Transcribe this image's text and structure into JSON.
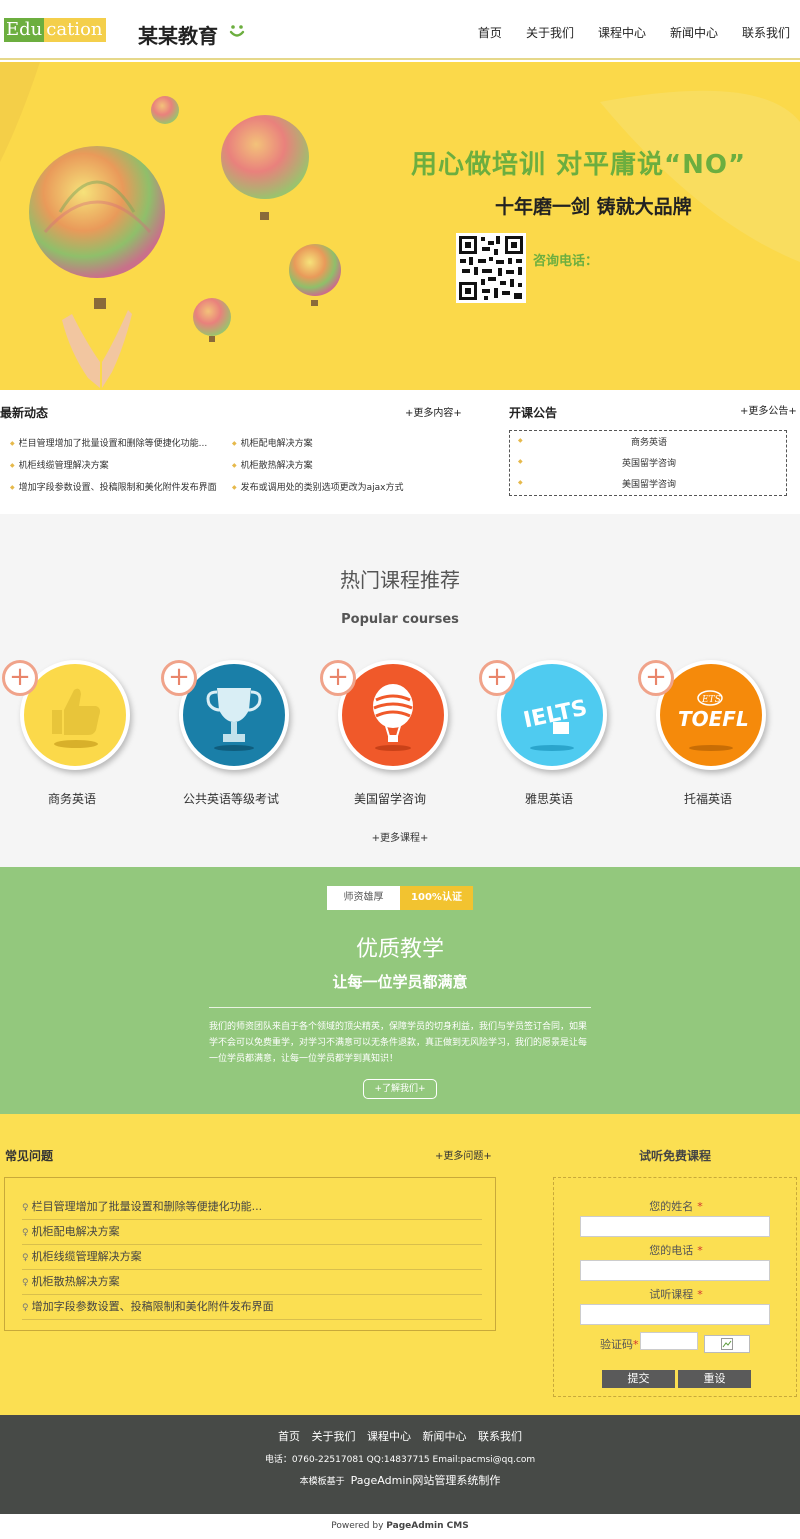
{
  "header": {
    "logo_left": "Edu",
    "logo_right": "cation",
    "site_name": "某某教育",
    "nav": [
      "首页",
      "关于我们",
      "课程中心",
      "新闻中心",
      "联系我们"
    ]
  },
  "banner": {
    "title": "用心做培训 对平庸说“NO”",
    "subtitle": "十年磨一剑 铸就大品牌",
    "phone_label": "咨询电话："
  },
  "news": {
    "title": "最新动态",
    "more": "+更多内容+",
    "items_left": [
      "栏目管理增加了批量设置和删除等便捷化功能...",
      "机柜线缆管理解决方案",
      "增加字段参数设置、投稿限制和美化附件发布界面"
    ],
    "items_right": [
      "机柜配电解决方案",
      "机柜散热解决方案",
      "发布或调用处的类别选项更改为ajax方式"
    ]
  },
  "notice": {
    "title": "开课公告",
    "more": "+更多公告+",
    "items": [
      "商务英语",
      "英国留学咨询",
      "美国留学咨询"
    ]
  },
  "courses": {
    "title": "热门课程推荐",
    "subtitle": "Popular courses",
    "plus": "+",
    "items": [
      {
        "name": "商务英语",
        "color": "#fbd94a"
      },
      {
        "name": "公共英语等级考试",
        "color": "#1a7fa8"
      },
      {
        "name": "美国留学咨询",
        "color": "#f0592a"
      },
      {
        "name": "雅思英语",
        "color": "#4fcbf0"
      },
      {
        "name": "托福英语",
        "color": "#f58a0b"
      }
    ],
    "ielts": "IELTS",
    "toefl": "TOEFL",
    "ets": "ETS",
    "more": "+更多课程+"
  },
  "quality": {
    "tag_left": "师资雄厚",
    "tag_right": "100%认证",
    "title": "优质教学",
    "subtitle": "让每一位学员都满意",
    "description": "我们的师资团队来自于各个领域的顶尖精英，保障学员的切身利益，我们与学员签订合同，如果学不会可以免费重学，对学习不满意可以无条件退款，真正做到无风险学习，我们的愿景是让每一位学员都满意，让每一位学员都学到真知识！",
    "button": "+了解我们+"
  },
  "faq": {
    "title": "常见问题",
    "more": "+更多问题+",
    "items": [
      "栏目管理增加了批量设置和删除等便捷化功能...",
      "机柜配电解决方案",
      "机柜线缆管理解决方案",
      "机柜散热解决方案",
      "增加字段参数设置、投稿限制和美化附件发布界面"
    ]
  },
  "trial": {
    "title": "试听免费课程",
    "name_label": "您的姓名",
    "phone_label": "您的电话",
    "course_label": "试听课程",
    "required": "*",
    "captcha_label": "验证码",
    "submit": "提交",
    "reset": "重设"
  },
  "footer": {
    "nav": [
      "首页",
      "关于我们",
      "课程中心",
      "新闻中心",
      "联系我们"
    ],
    "contact": "电话：0760-22517081 QQ:14837715  Email:pacmsi@qq.com",
    "made_prefix": "本模板基于",
    "made_brand": "PageAdmin网站管理系统制作",
    "powered_prefix": "Powered by",
    "powered_brand": "PageAdmin CMS"
  }
}
